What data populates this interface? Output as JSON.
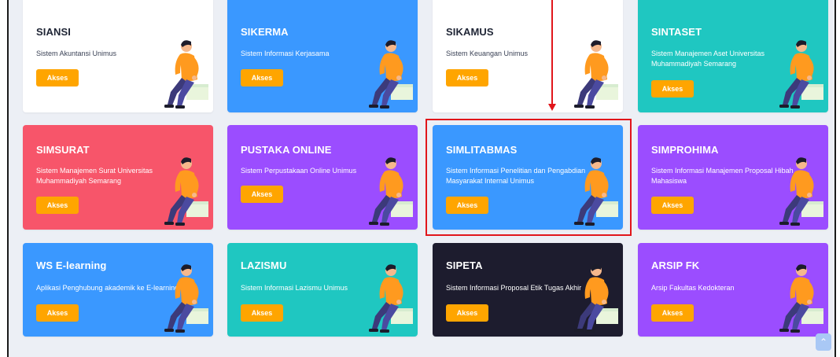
{
  "colors": {
    "white": "#ffffff",
    "blue": "#3a98ff",
    "teal": "#1fc7c1",
    "red": "#f7556a",
    "purple": "#9b4dff",
    "navy": "#1d1c2e",
    "button": "#ffa500",
    "highlight": "#e1161b"
  },
  "cards": [
    {
      "title": "SIANSI",
      "desc": "Sistem Akuntansi Unimus",
      "button": "Akses",
      "icon": "person-sitting-illustration"
    },
    {
      "title": "SIKERMA",
      "desc": "Sistem Informasi Kerjasama",
      "button": "Akses",
      "icon": "person-sitting-illustration"
    },
    {
      "title": "SIKAMUS",
      "desc": "Sistem Keuangan Unimus",
      "button": "Akses",
      "icon": "person-sitting-illustration"
    },
    {
      "title": "SINTASET",
      "desc": "Sistem Manajemen Aset Universitas Muhammadiyah Semarang",
      "button": "Akses",
      "icon": "person-sitting-illustration"
    },
    {
      "title": "SIMSURAT",
      "desc": "Sistem Manajemen Surat Universitas Muhammadiyah Semarang",
      "button": "Akses",
      "icon": "person-sitting-illustration"
    },
    {
      "title": "PUSTAKA ONLINE",
      "desc": "Sistem Perpustakaan Online Unimus",
      "button": "Akses",
      "icon": "person-sitting-illustration"
    },
    {
      "title": "SIMLITABMAS",
      "desc": "Sistem Informasi Penelitian dan Pengabdian Masyarakat Internal Unimus",
      "button": "Akses",
      "icon": "person-sitting-illustration"
    },
    {
      "title": "SIMPROHIMA",
      "desc": "Sistem Informasi Manajemen Proposal Hibah Mahasiswa",
      "button": "Akses",
      "icon": "person-sitting-illustration"
    },
    {
      "title": "WS E-learning",
      "desc": "Aplikasi Penghubung akademik ke E-learning",
      "button": "Akses",
      "icon": "person-sitting-illustration"
    },
    {
      "title": "LAZISMU",
      "desc": "Sistem Informasi Lazismu Unimus",
      "button": "Akses",
      "icon": "person-sitting-illustration"
    },
    {
      "title": "SIPETA",
      "desc": "Sistem Informasi Proposal Etik Tugas Akhir",
      "button": "Akses",
      "icon": "person-sitting-illustration"
    },
    {
      "title": "ARSIP FK",
      "desc": "Arsip Fakultas Kedokteran",
      "button": "Akses",
      "icon": "person-sitting-illustration"
    }
  ],
  "scroll_top": {
    "icon": "chevron-up-icon",
    "glyph": "⌃"
  }
}
